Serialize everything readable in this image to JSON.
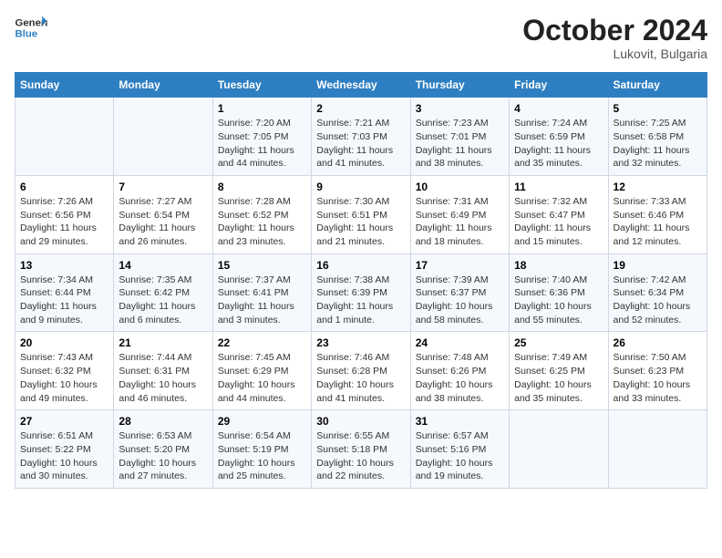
{
  "header": {
    "logo_line1": "General",
    "logo_line2": "Blue",
    "month": "October 2024",
    "location": "Lukovit, Bulgaria"
  },
  "days_of_week": [
    "Sunday",
    "Monday",
    "Tuesday",
    "Wednesday",
    "Thursday",
    "Friday",
    "Saturday"
  ],
  "weeks": [
    [
      {
        "day": "",
        "info": ""
      },
      {
        "day": "",
        "info": ""
      },
      {
        "day": "1",
        "info": "Sunrise: 7:20 AM\nSunset: 7:05 PM\nDaylight: 11 hours and 44 minutes."
      },
      {
        "day": "2",
        "info": "Sunrise: 7:21 AM\nSunset: 7:03 PM\nDaylight: 11 hours and 41 minutes."
      },
      {
        "day": "3",
        "info": "Sunrise: 7:23 AM\nSunset: 7:01 PM\nDaylight: 11 hours and 38 minutes."
      },
      {
        "day": "4",
        "info": "Sunrise: 7:24 AM\nSunset: 6:59 PM\nDaylight: 11 hours and 35 minutes."
      },
      {
        "day": "5",
        "info": "Sunrise: 7:25 AM\nSunset: 6:58 PM\nDaylight: 11 hours and 32 minutes."
      }
    ],
    [
      {
        "day": "6",
        "info": "Sunrise: 7:26 AM\nSunset: 6:56 PM\nDaylight: 11 hours and 29 minutes."
      },
      {
        "day": "7",
        "info": "Sunrise: 7:27 AM\nSunset: 6:54 PM\nDaylight: 11 hours and 26 minutes."
      },
      {
        "day": "8",
        "info": "Sunrise: 7:28 AM\nSunset: 6:52 PM\nDaylight: 11 hours and 23 minutes."
      },
      {
        "day": "9",
        "info": "Sunrise: 7:30 AM\nSunset: 6:51 PM\nDaylight: 11 hours and 21 minutes."
      },
      {
        "day": "10",
        "info": "Sunrise: 7:31 AM\nSunset: 6:49 PM\nDaylight: 11 hours and 18 minutes."
      },
      {
        "day": "11",
        "info": "Sunrise: 7:32 AM\nSunset: 6:47 PM\nDaylight: 11 hours and 15 minutes."
      },
      {
        "day": "12",
        "info": "Sunrise: 7:33 AM\nSunset: 6:46 PM\nDaylight: 11 hours and 12 minutes."
      }
    ],
    [
      {
        "day": "13",
        "info": "Sunrise: 7:34 AM\nSunset: 6:44 PM\nDaylight: 11 hours and 9 minutes."
      },
      {
        "day": "14",
        "info": "Sunrise: 7:35 AM\nSunset: 6:42 PM\nDaylight: 11 hours and 6 minutes."
      },
      {
        "day": "15",
        "info": "Sunrise: 7:37 AM\nSunset: 6:41 PM\nDaylight: 11 hours and 3 minutes."
      },
      {
        "day": "16",
        "info": "Sunrise: 7:38 AM\nSunset: 6:39 PM\nDaylight: 11 hours and 1 minute."
      },
      {
        "day": "17",
        "info": "Sunrise: 7:39 AM\nSunset: 6:37 PM\nDaylight: 10 hours and 58 minutes."
      },
      {
        "day": "18",
        "info": "Sunrise: 7:40 AM\nSunset: 6:36 PM\nDaylight: 10 hours and 55 minutes."
      },
      {
        "day": "19",
        "info": "Sunrise: 7:42 AM\nSunset: 6:34 PM\nDaylight: 10 hours and 52 minutes."
      }
    ],
    [
      {
        "day": "20",
        "info": "Sunrise: 7:43 AM\nSunset: 6:32 PM\nDaylight: 10 hours and 49 minutes."
      },
      {
        "day": "21",
        "info": "Sunrise: 7:44 AM\nSunset: 6:31 PM\nDaylight: 10 hours and 46 minutes."
      },
      {
        "day": "22",
        "info": "Sunrise: 7:45 AM\nSunset: 6:29 PM\nDaylight: 10 hours and 44 minutes."
      },
      {
        "day": "23",
        "info": "Sunrise: 7:46 AM\nSunset: 6:28 PM\nDaylight: 10 hours and 41 minutes."
      },
      {
        "day": "24",
        "info": "Sunrise: 7:48 AM\nSunset: 6:26 PM\nDaylight: 10 hours and 38 minutes."
      },
      {
        "day": "25",
        "info": "Sunrise: 7:49 AM\nSunset: 6:25 PM\nDaylight: 10 hours and 35 minutes."
      },
      {
        "day": "26",
        "info": "Sunrise: 7:50 AM\nSunset: 6:23 PM\nDaylight: 10 hours and 33 minutes."
      }
    ],
    [
      {
        "day": "27",
        "info": "Sunrise: 6:51 AM\nSunset: 5:22 PM\nDaylight: 10 hours and 30 minutes."
      },
      {
        "day": "28",
        "info": "Sunrise: 6:53 AM\nSunset: 5:20 PM\nDaylight: 10 hours and 27 minutes."
      },
      {
        "day": "29",
        "info": "Sunrise: 6:54 AM\nSunset: 5:19 PM\nDaylight: 10 hours and 25 minutes."
      },
      {
        "day": "30",
        "info": "Sunrise: 6:55 AM\nSunset: 5:18 PM\nDaylight: 10 hours and 22 minutes."
      },
      {
        "day": "31",
        "info": "Sunrise: 6:57 AM\nSunset: 5:16 PM\nDaylight: 10 hours and 19 minutes."
      },
      {
        "day": "",
        "info": ""
      },
      {
        "day": "",
        "info": ""
      }
    ]
  ]
}
